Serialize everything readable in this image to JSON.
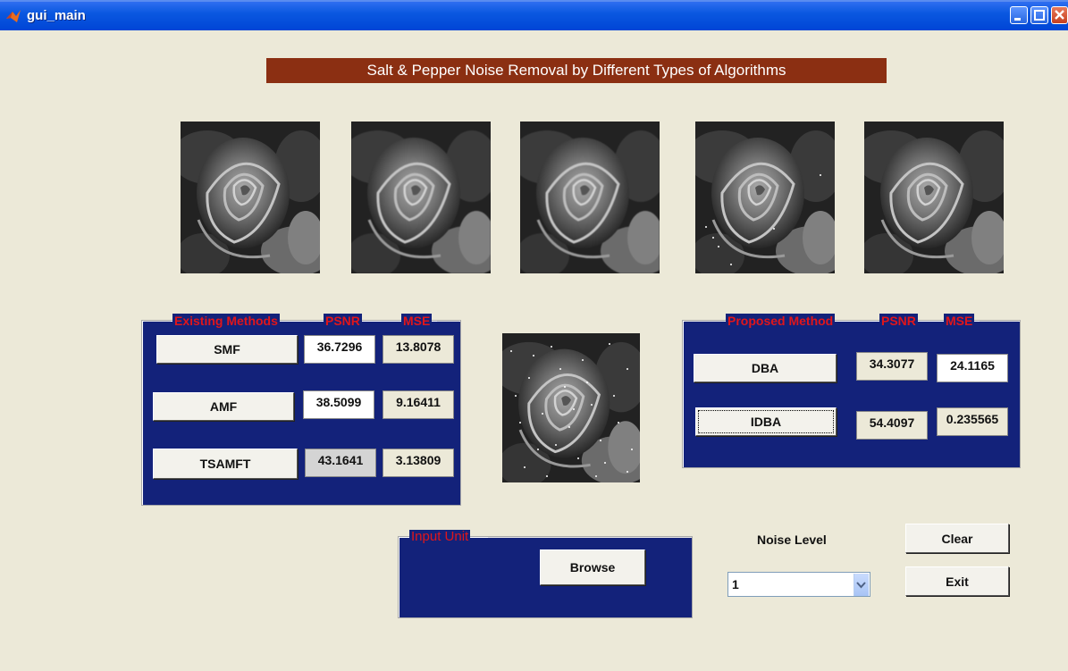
{
  "window": {
    "title": "gui_main",
    "icon": "matlab-icon",
    "controls": [
      "minimize-icon",
      "maximize-icon",
      "close-icon"
    ]
  },
  "heading": "Salt & Pepper Noise Removal by Different Types of Algorithms",
  "images": [
    "rose-original",
    "rose-filtered-1",
    "rose-filtered-2",
    "rose-filtered-3",
    "rose-filtered-4",
    "rose-noisy"
  ],
  "existing_panel": {
    "legend_title": "Existing Methods",
    "psnr_header": "PSNR",
    "mse_header": "MSE",
    "rows": [
      {
        "method": "SMF",
        "psnr": "36.7296",
        "mse": "13.8078"
      },
      {
        "method": "AMF",
        "psnr": "38.5099",
        "mse": "9.16411"
      },
      {
        "method": "TSAMFT",
        "psnr": "43.1641",
        "mse": "3.13809"
      }
    ]
  },
  "proposed_panel": {
    "legend_title": "Proposed Method",
    "psnr_header": "PSNR",
    "mse_header": "MSE",
    "rows": [
      {
        "method": "DBA",
        "psnr": "34.3077",
        "mse": "24.1165"
      },
      {
        "method": "IDBA",
        "psnr": "54.4097",
        "mse": "0.235565"
      }
    ]
  },
  "input_panel": {
    "legend_title": "Input Unit",
    "browse_label": "Browse"
  },
  "noise": {
    "label": "Noise Level",
    "selected": "1"
  },
  "actions": {
    "clear_label": "Clear",
    "exit_label": "Exit"
  },
  "colors": {
    "panel_bg": "#13227a",
    "legend_red": "#e0161b",
    "heading_bg": "#8b2f12",
    "window_bg": "#ece9d8"
  }
}
